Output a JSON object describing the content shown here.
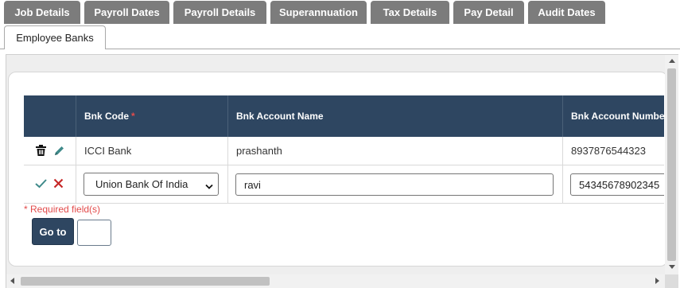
{
  "tabs": [
    {
      "label": "Job Details"
    },
    {
      "label": "Payroll Dates"
    },
    {
      "label": "Payroll Details"
    },
    {
      "label": "Superannuation"
    },
    {
      "label": "Tax Details"
    },
    {
      "label": "Pay Detail"
    },
    {
      "label": "Audit Dates"
    }
  ],
  "active_tab": {
    "label": "Employee Banks"
  },
  "table": {
    "headers": {
      "code": "Bnk Code",
      "required_mark": "*",
      "account_name": "Bnk Account Name",
      "account_number": "Bnk Account Numbe"
    },
    "row1": {
      "code": "ICCI Bank",
      "account_name": "prashanth",
      "account_number": "8937876544323"
    },
    "edit_row": {
      "code_selected": "Union Bank Of India",
      "account_name_value": "ravi",
      "account_number_value": "54345678902345"
    }
  },
  "required_note": "* Required field(s)",
  "goto": {
    "button_label": "Go to",
    "input_value": ""
  },
  "colors": {
    "tab_bg": "#7c7c7c",
    "header_bg": "#2e4661",
    "required": "#e24b4b",
    "edit_icon": "#3f8a8a",
    "cancel_icon": "#c62828"
  }
}
